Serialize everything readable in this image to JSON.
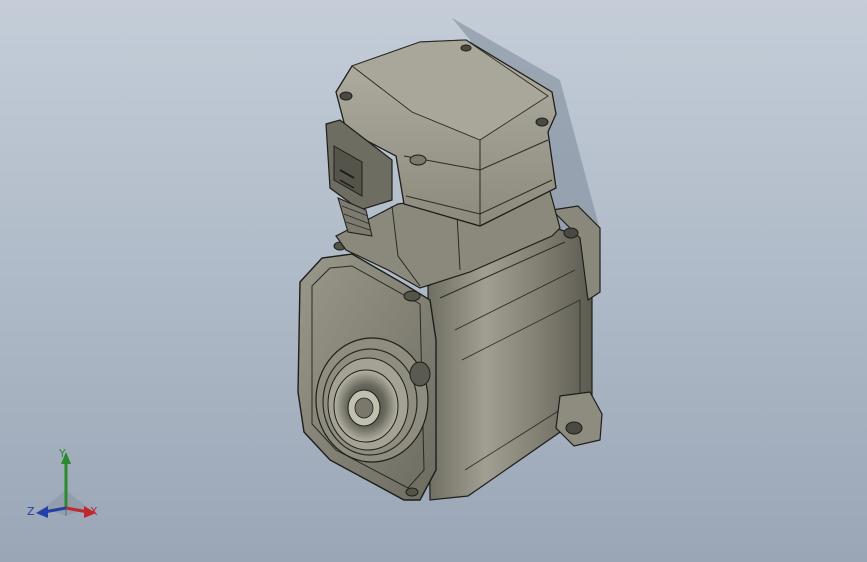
{
  "view": {
    "background_top": "#c4cdd8",
    "background_bottom": "#9aa6b6",
    "model_body_color": "#8d8b7d",
    "model_edge_color": "#1e1e1a"
  },
  "triad": {
    "x_label": "X",
    "y_label": "Y",
    "z_label": "Z",
    "x_color": "#c0282d",
    "y_color": "#2b8a2b",
    "z_color": "#2240a6"
  },
  "icons": [
    "servo-motor-model",
    "axis-triad-icon"
  ]
}
